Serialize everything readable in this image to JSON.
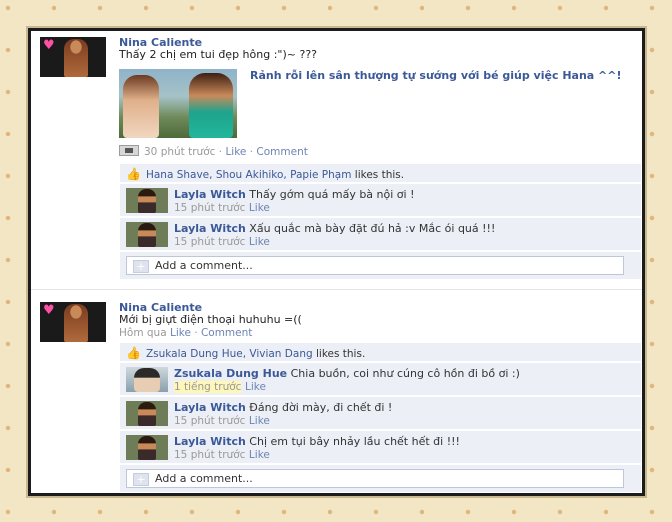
{
  "posts": [
    {
      "author": "Nina Caliente",
      "status": "Thấy 2 chị em tui đẹp hông :\")~ ???",
      "photo_caption": "Rảnh rỗi lên sân thượng tự sướng với bé giúp việc Hana ^^!",
      "meta": {
        "time": "30 phút trước",
        "sep1": " · ",
        "like": "Like",
        "sep2": " · ",
        "comment": "Comment"
      },
      "likes": {
        "names": "Hana Shave, Shou Akihiko, Papie Phạm",
        "suffix": " likes this."
      },
      "comments": [
        {
          "author": "Layla Witch",
          "text": " Thấy gớm quá mấy bà nội ơi !",
          "time": "15 phút trước",
          "like": "Like"
        },
        {
          "author": "Layla Witch",
          "text": " Xấu quắc mà bày đặt đú hả :v Mắc ói quá !!!",
          "time": "15 phút trước",
          "like": "Like"
        }
      ],
      "add_comment": "Add a comment..."
    },
    {
      "author": "Nina Caliente",
      "status": "Mới bị giựt điện thoại huhuhu =((",
      "meta": {
        "time": "Hôm qua",
        "like": "Like",
        "sep": " · ",
        "comment": "Comment"
      },
      "likes": {
        "names": "Zsukala Dung Hue, Vivian Dang",
        "suffix": " likes this."
      },
      "comments": [
        {
          "author": "Zsukala Dung Hue",
          "text": " Chia buồn, coi như cúng cô hồn đi bồ ơi :)",
          "time": "1 tiếng trước",
          "like": "Like"
        },
        {
          "author": "Layla Witch",
          "text": " Đáng đời mày, đi chết đi !",
          "time": "15 phút trước",
          "like": "Like"
        },
        {
          "author": "Layla Witch",
          "text": " Chị em tụi bây nhảy lầu chết hết đi !!!",
          "time": "15 phút trước",
          "like": "Like"
        }
      ],
      "add_comment": "Add a comment..."
    }
  ]
}
